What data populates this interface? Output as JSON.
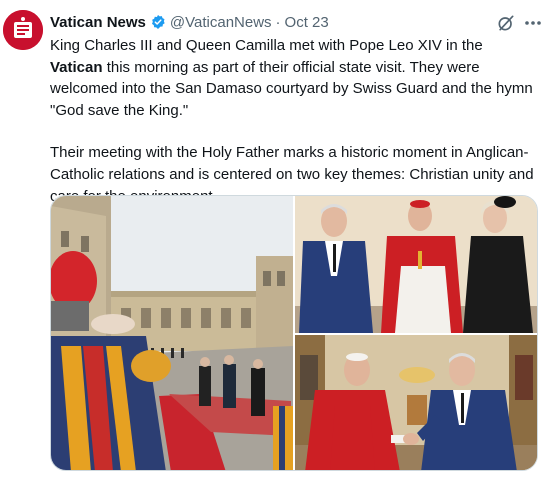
{
  "post": {
    "author_name": "Vatican News",
    "handle": "@VaticanNews",
    "separator": "·",
    "date": "Oct 23",
    "paragraph1": {
      "before": "King Charles III and Queen Camilla met with Pope Leo XIV in the ",
      "bold": "Vatican",
      "after": " this morning as part of their official state visit. They were welcomed into the San Damaso courtyard by Swiss Guard and the hymn \"God save the King.\""
    },
    "paragraph2": "Their meeting with the Holy Father marks a historic moment in Anglican-Catholic relations and is centered on two key themes: Christian unity and care for the environment."
  },
  "icons": {
    "avatar": "vatican-news-logo",
    "verified": "verified-badge-icon",
    "grok": "grok-icon",
    "more": "more-icon"
  },
  "colors": {
    "avatar_bg": "#c8102e",
    "verified_blue": "#1d9bf0",
    "secondary_text": "#536471",
    "body_text": "#0f1419"
  },
  "media": {
    "photo_count": 3
  }
}
